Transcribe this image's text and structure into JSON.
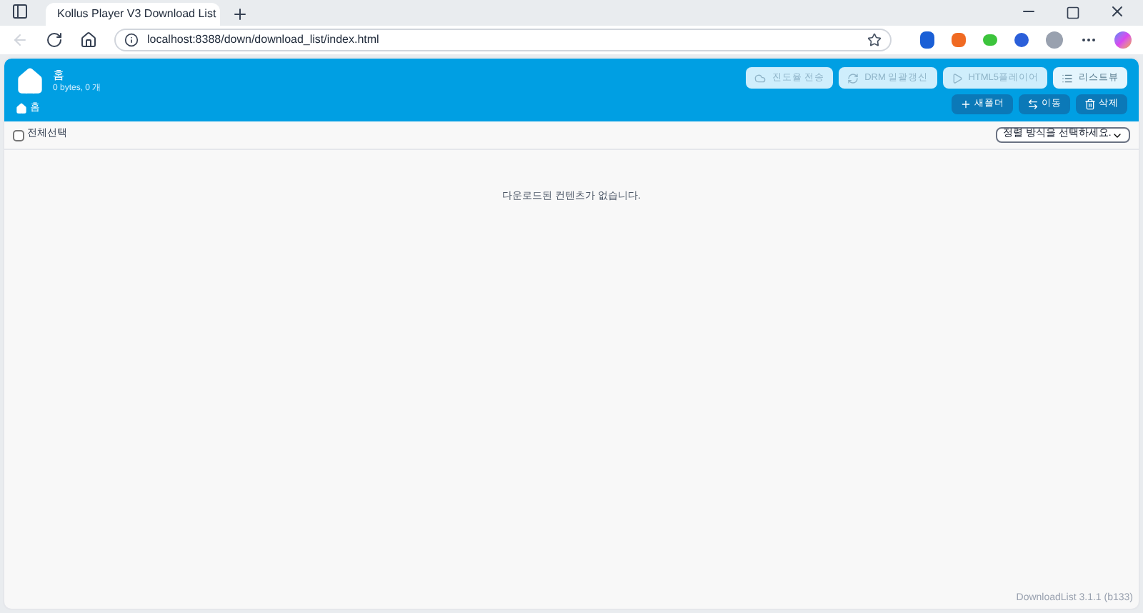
{
  "browser": {
    "tab_title": "Kollus Player V3 Download List",
    "url": "localhost:8388/down/download_list/index.html"
  },
  "header": {
    "title": "홈",
    "summary": "0 bytes, 0 개",
    "breadcrumb": "홈"
  },
  "top_buttons": [
    {
      "label": "진도율 전송",
      "disabled": true
    },
    {
      "label": "DRM 일괄갱신",
      "disabled": true
    },
    {
      "label": "HTML5플레이어",
      "disabled": true
    },
    {
      "label": "리스트뷰",
      "disabled": false
    }
  ],
  "action_buttons": [
    {
      "label": "새폴더"
    },
    {
      "label": "이동"
    },
    {
      "label": "삭제"
    }
  ],
  "select_all": {
    "label": "전체선택",
    "checked": false
  },
  "sort": {
    "placeholder": "정렬 방식을 선택하세요."
  },
  "empty_message": "다운로드된 컨텐츠가 없습니다.",
  "version": "DownloadList 3.1.1 (b133)"
}
